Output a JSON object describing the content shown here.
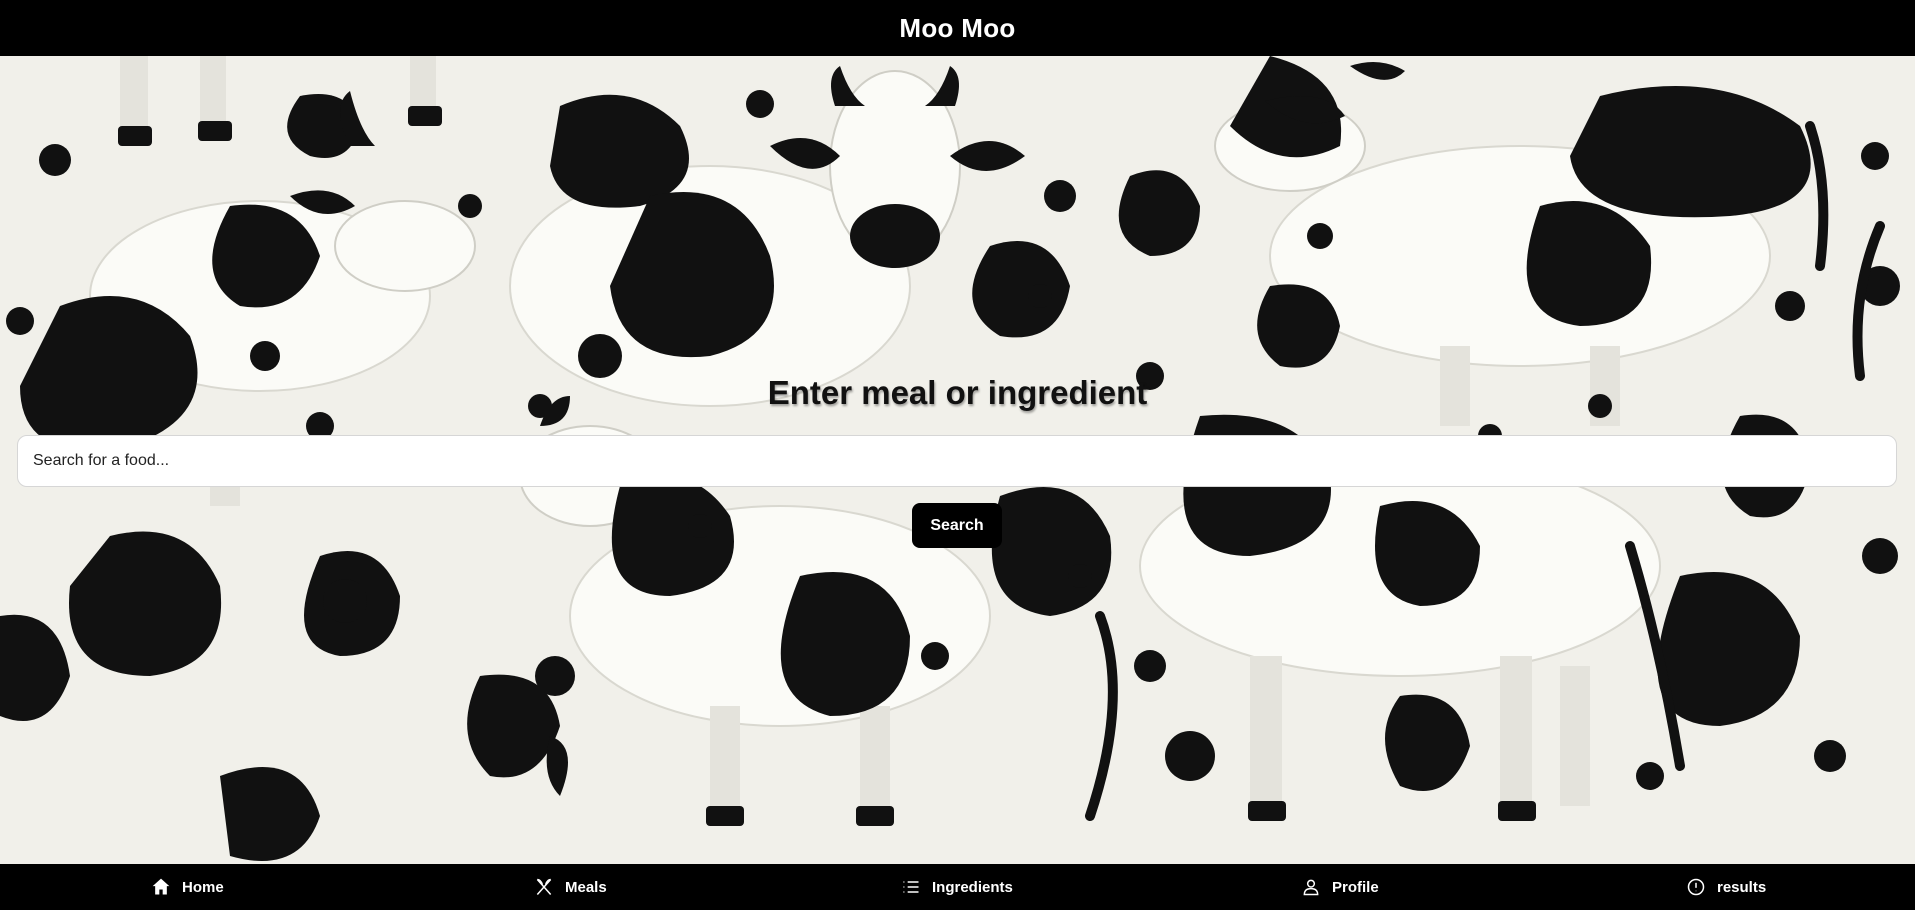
{
  "header": {
    "title": "Moo Moo"
  },
  "main": {
    "headline": "Enter meal or ingredient",
    "search": {
      "placeholder": "Search for a food...",
      "value": ""
    },
    "search_button_label": "Search"
  },
  "bottom_nav": {
    "items": [
      {
        "label": "Home",
        "icon": "home-icon"
      },
      {
        "label": "Meals",
        "icon": "utensils-icon"
      },
      {
        "label": "Ingredients",
        "icon": "list-icon"
      },
      {
        "label": "Profile",
        "icon": "user-icon"
      },
      {
        "label": "results",
        "icon": "alert-circle-icon"
      }
    ]
  },
  "colors": {
    "bar": "#000000",
    "background": "#f1f0ea",
    "spots": "#111111",
    "text": "#ffffff"
  }
}
